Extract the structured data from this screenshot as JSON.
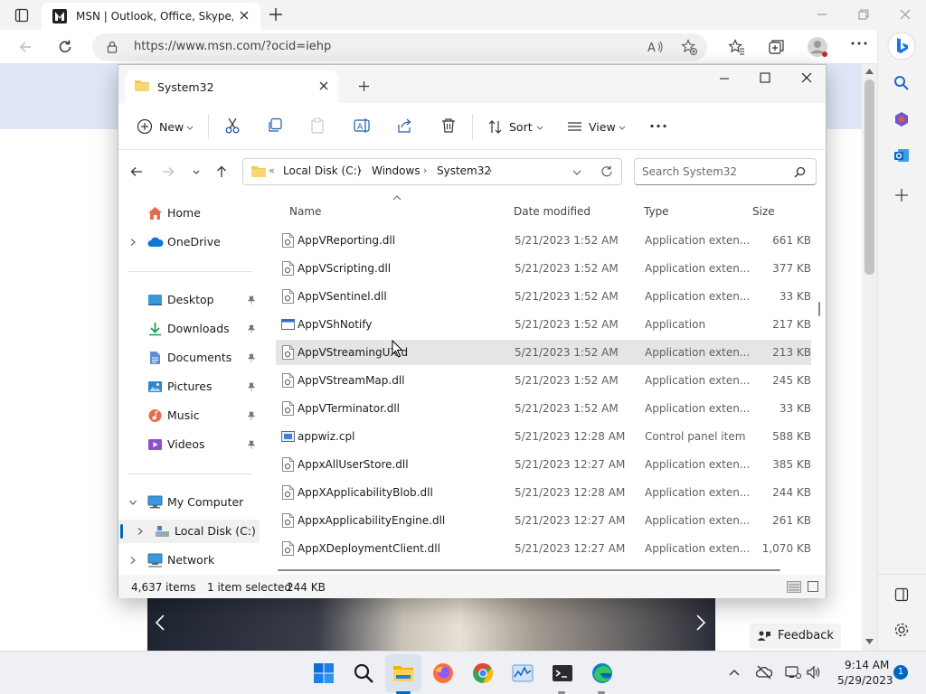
{
  "browser": {
    "tab_title": "MSN | Outlook, Office, Skype, Bi",
    "url": "https://www.msn.com/?ocid=iehp",
    "feedback_label": "Feedback"
  },
  "explorer": {
    "tab_title": "System32",
    "toolbar": {
      "new_label": "New",
      "sort_label": "Sort",
      "view_label": "View"
    },
    "breadcrumb": {
      "root": "Local Disk (C:)",
      "folder1": "Windows",
      "folder2": "System32"
    },
    "search_placeholder": "Search System32",
    "nav": {
      "home": "Home",
      "onedrive": "OneDrive",
      "desktop": "Desktop",
      "downloads": "Downloads",
      "documents": "Documents",
      "pictures": "Pictures",
      "music": "Music",
      "videos": "Videos",
      "my_computer": "My Computer",
      "local_disk": "Local Disk (C:)",
      "network": "Network"
    },
    "columns": {
      "name": "Name",
      "date": "Date modified",
      "type": "Type",
      "size": "Size"
    },
    "files": [
      {
        "name": "AppVReporting.dll",
        "date": "5/21/2023 1:52 AM",
        "type": "Application exten...",
        "size": "661 KB",
        "icon": "dll-icon"
      },
      {
        "name": "AppVScripting.dll",
        "date": "5/21/2023 1:52 AM",
        "type": "Application exten...",
        "size": "377 KB",
        "icon": "dll-icon"
      },
      {
        "name": "AppVSentinel.dll",
        "date": "5/21/2023 1:52 AM",
        "type": "Application exten...",
        "size": "33 KB",
        "icon": "dll-icon"
      },
      {
        "name": "AppVShNotify",
        "date": "5/21/2023 1:52 AM",
        "type": "Application",
        "size": "217 KB",
        "icon": "exe-icon"
      },
      {
        "name": "AppVStreamingUX.d",
        "date": "5/21/2023 1:52 AM",
        "type": "Application exten...",
        "size": "213 KB",
        "icon": "dll-icon"
      },
      {
        "name": "AppVStreamMap.dll",
        "date": "5/21/2023 1:52 AM",
        "type": "Application exten...",
        "size": "245 KB",
        "icon": "dll-icon"
      },
      {
        "name": "AppVTerminator.dll",
        "date": "5/21/2023 1:52 AM",
        "type": "Application exten...",
        "size": "33 KB",
        "icon": "dll-icon"
      },
      {
        "name": "appwiz.cpl",
        "date": "5/21/2023 12:28 AM",
        "type": "Control panel item",
        "size": "588 KB",
        "icon": "cpl-icon"
      },
      {
        "name": "AppxAllUserStore.dll",
        "date": "5/21/2023 12:27 AM",
        "type": "Application exten...",
        "size": "385 KB",
        "icon": "dll-icon"
      },
      {
        "name": "AppXApplicabilityBlob.dll",
        "date": "5/21/2023 12:28 AM",
        "type": "Application exten...",
        "size": "244 KB",
        "icon": "dll-icon"
      },
      {
        "name": "AppxApplicabilityEngine.dll",
        "date": "5/21/2023 12:27 AM",
        "type": "Application exten...",
        "size": "261 KB",
        "icon": "dll-icon"
      },
      {
        "name": "AppXDeploymentClient.dll",
        "date": "5/21/2023 12:27 AM",
        "type": "Application exten...",
        "size": "1,070 KB",
        "icon": "dll-icon"
      }
    ],
    "status": {
      "item_count": "4,637 items",
      "selection": "1 item selected",
      "selection_size": "244 KB"
    }
  },
  "taskbar": {
    "time": "9:14 AM",
    "date": "5/29/2023",
    "notification_count": "1"
  },
  "colors": {
    "accent": "#0067c0",
    "folder": "#f2c94c",
    "selection": "#e5e5e5"
  }
}
